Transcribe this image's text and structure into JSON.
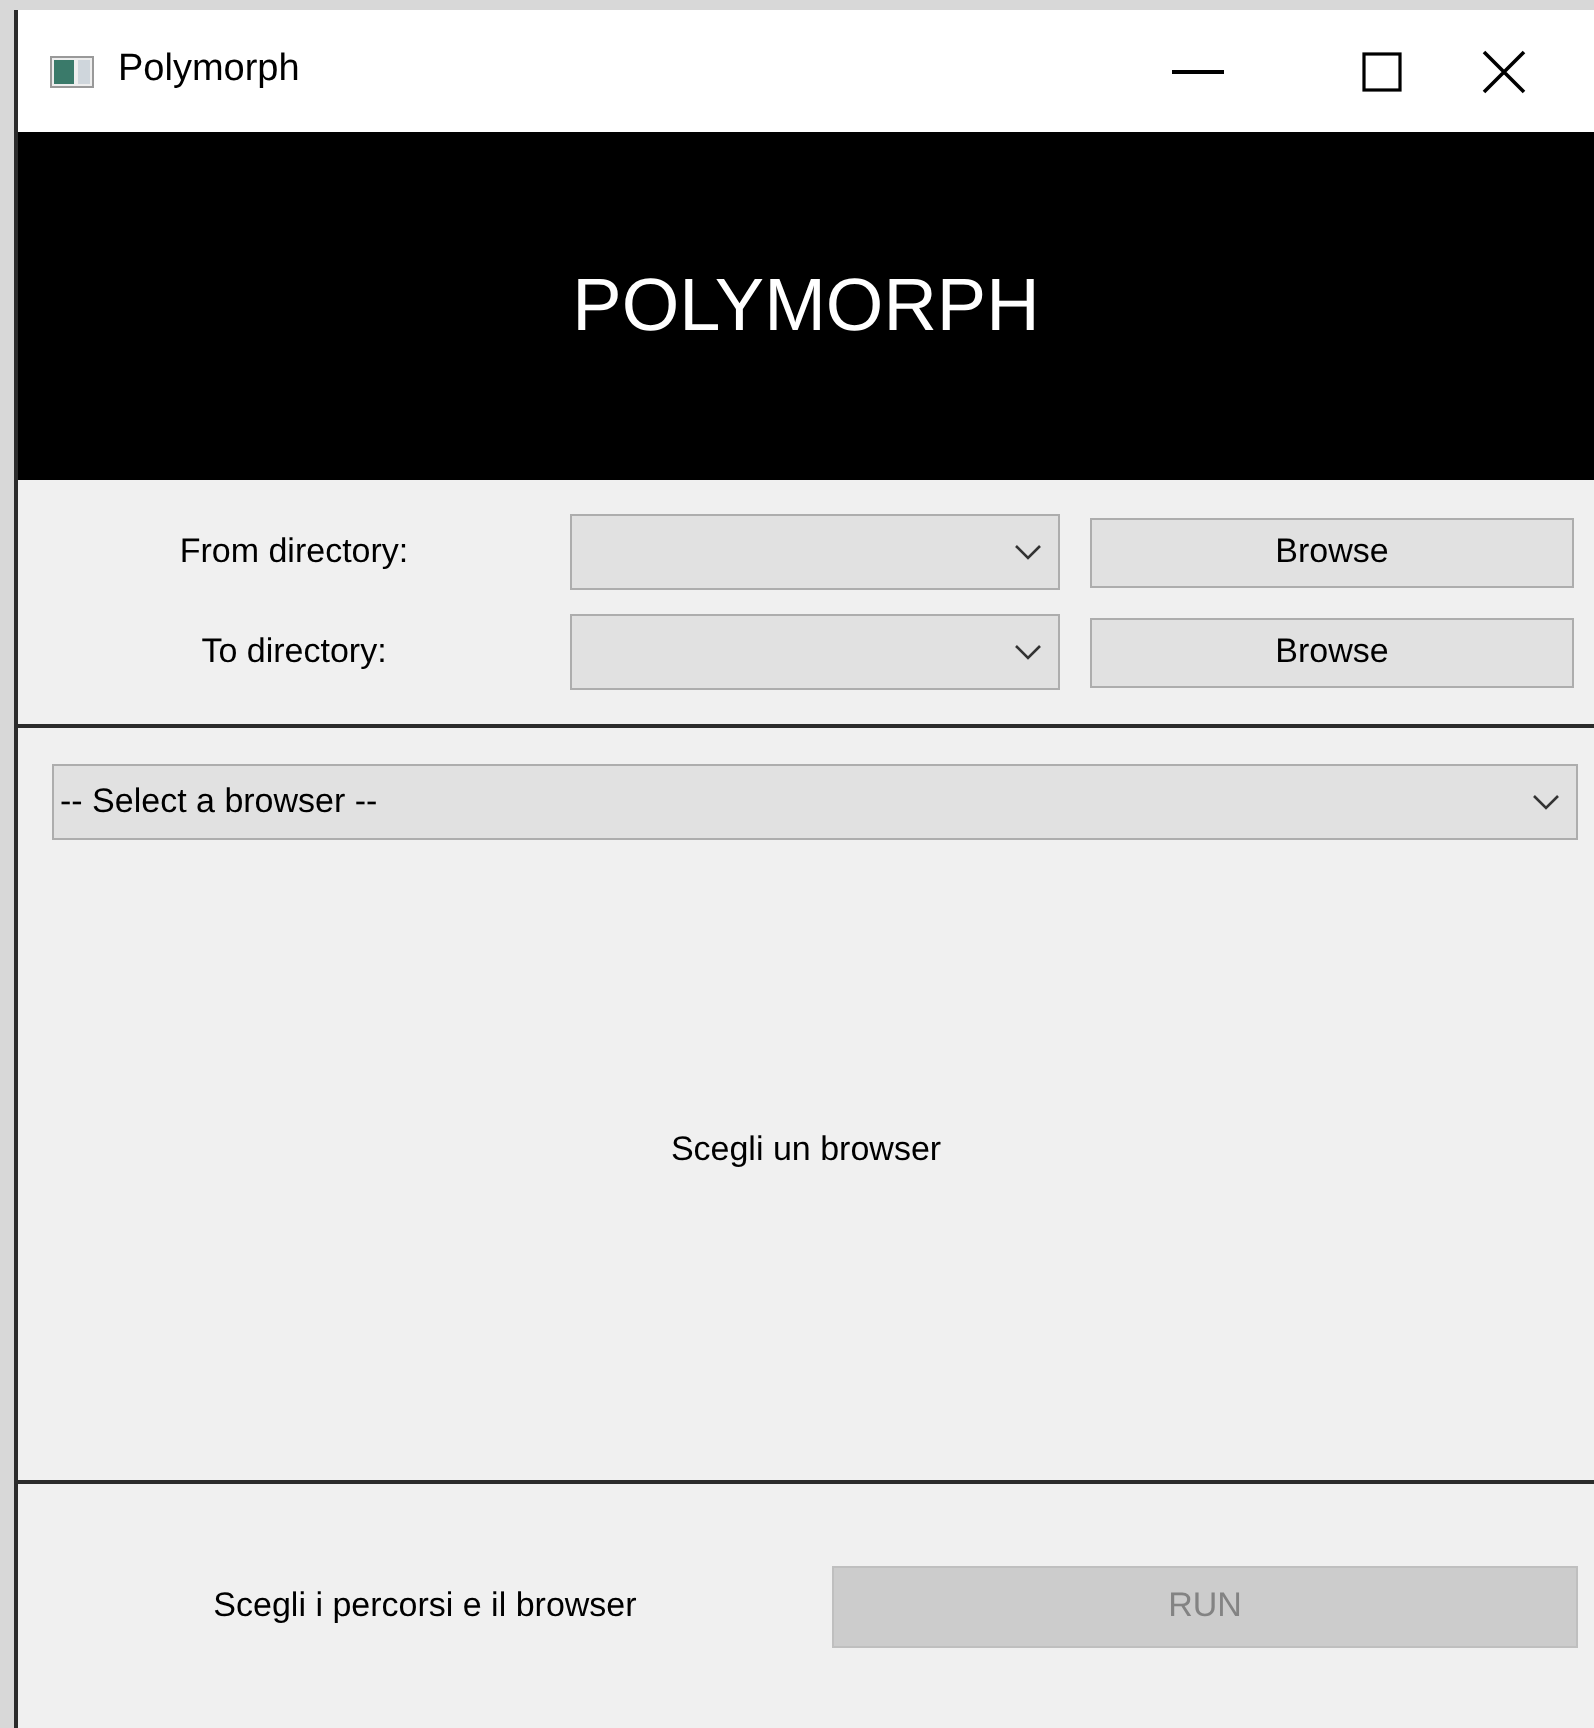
{
  "window": {
    "title": "Polymorph"
  },
  "banner": {
    "title": "POLYMORPH"
  },
  "directories": [
    {
      "label": "From directory:",
      "button": "Browse"
    },
    {
      "label": "To directory:",
      "button": "Browse"
    }
  ],
  "browser_select": {
    "value": "-- Select a browser --"
  },
  "message": "Scegli un browser",
  "status": "Scegli i percorsi e il browser",
  "run_button": {
    "label": "RUN",
    "disabled": true
  }
}
